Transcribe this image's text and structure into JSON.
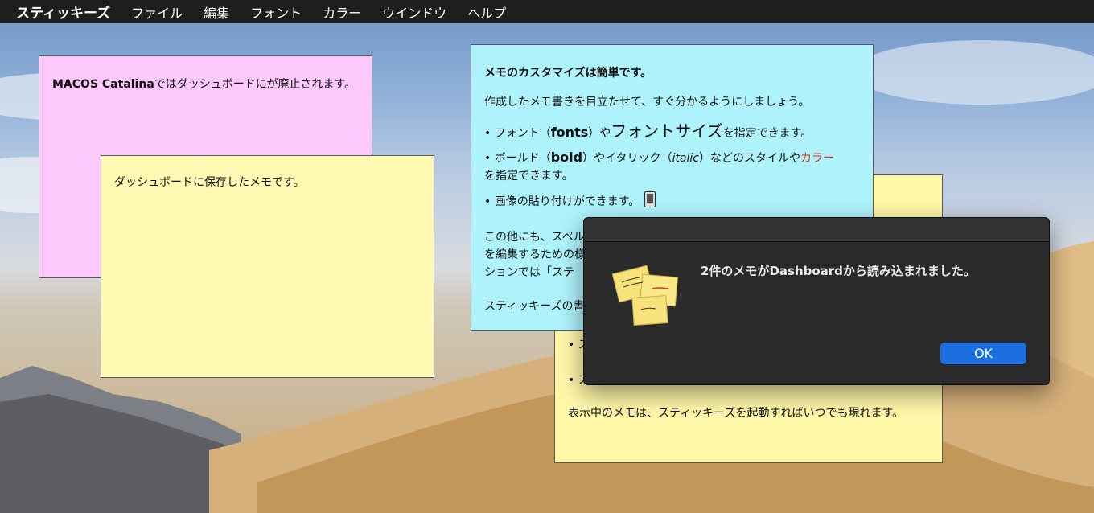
{
  "menubar": {
    "app_name": "スティッキーズ",
    "items": [
      "ファイル",
      "編集",
      "フォント",
      "カラー",
      "ウインドウ",
      "ヘルプ"
    ]
  },
  "notes": {
    "pink": {
      "bold_part": "MACOS Catalina",
      "text": "ではダッシュボードにが廃止されます。"
    },
    "yellow1": {
      "text": "ダッシュボードに保存したメモです。"
    },
    "blue": {
      "heading": "メモのカスタマイズは簡単です。",
      "intro": "作成したメモ書きを目立たせて、すぐ分かるようにしましょう。",
      "bullet1_pre": "• フォント（",
      "bullet1_bold": "fonts",
      "bullet1_mid": "）や",
      "bullet1_big": "フォントサイズ",
      "bullet1_post": "を指定できます。",
      "bullet2_pre": "• ボールド（",
      "bullet2_bold": "bold",
      "bullet2_mid": "）やイタリック（",
      "bullet2_italic": "italic",
      "bullet2_mid2": "）などのスタイルや",
      "bullet2_red": "カラー",
      "bullet2_post": "を指定できます。",
      "bullet3": "• 画像の貼り付けができます。",
      "partial1": "この他にも、スペル",
      "partial2": "を編集するための様",
      "partial3": "ションでは「ステ",
      "partial4": "スティッキーズの書"
    },
    "yellow2": {
      "bullet_a": "• ス",
      "bullet_b": "• ス",
      "footer": "表示中のメモは、スティッキーズを起動すればいつでも現れます。"
    }
  },
  "dialog": {
    "message": "2件のメモがDashboardから読み込まれました。",
    "ok_label": "OK",
    "icon": "stickies-app-icon"
  },
  "colors": {
    "pink_note": "#fdc9fd",
    "yellow_note": "#fff9b3",
    "blue_note": "#aef3fc",
    "dialog_bg": "#2a2a2a",
    "ok_button": "#1b6fe0",
    "accent_red": "#e2341c"
  }
}
